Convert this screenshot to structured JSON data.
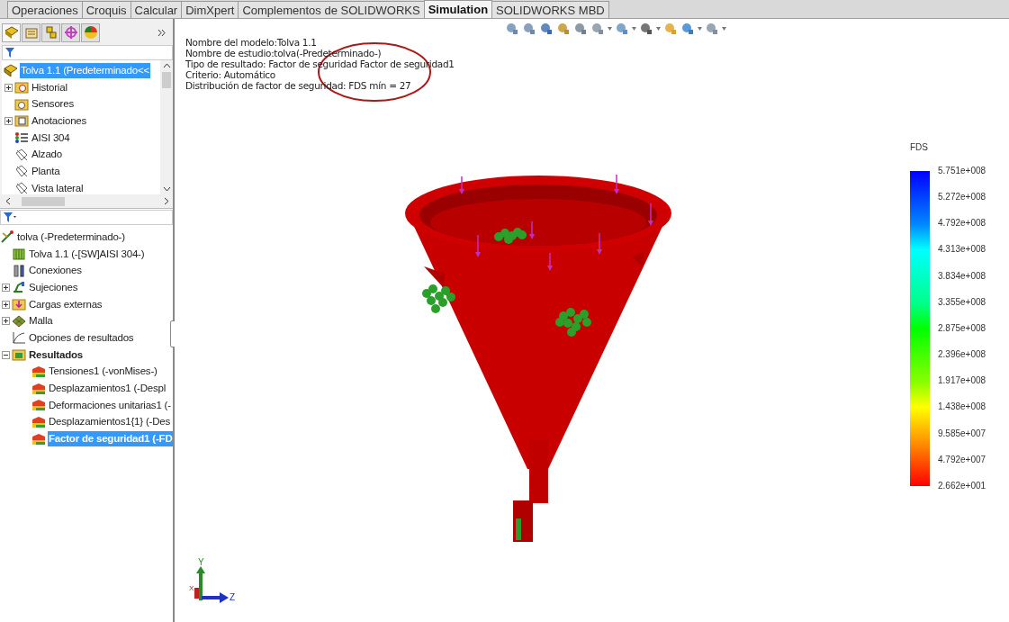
{
  "tabs": [
    {
      "label": "Operaciones",
      "selected": false
    },
    {
      "label": "Croquis",
      "selected": false
    },
    {
      "label": "Calcular",
      "selected": false
    },
    {
      "label": "DimXpert",
      "selected": false
    },
    {
      "label": "Complementos de SOLIDWORKS",
      "selected": false
    },
    {
      "label": "Simulation",
      "selected": true
    },
    {
      "label": "SOLIDWORKS MBD",
      "selected": false
    }
  ],
  "feature_tree": {
    "items": [
      {
        "label": "Tolva 1.1  (Predeterminado<<",
        "kind": "part",
        "selected": true,
        "bold": false,
        "children": [
          {
            "label": "Historial",
            "kind": "history",
            "expanded": false,
            "selected": false,
            "bold": false
          },
          {
            "label": "Sensores",
            "kind": "sensor",
            "selected": false,
            "bold": false
          },
          {
            "label": "Anotaciones",
            "kind": "annotation",
            "expanded": false,
            "selected": false,
            "bold": false
          },
          {
            "label": "AISI 304",
            "kind": "material",
            "selected": false,
            "bold": false
          },
          {
            "label": "Alzado",
            "kind": "plane",
            "selected": false,
            "bold": false
          },
          {
            "label": "Planta",
            "kind": "plane",
            "selected": false,
            "bold": false
          },
          {
            "label": "Vista lateral",
            "kind": "plane",
            "selected": false,
            "bold": false
          }
        ]
      }
    ]
  },
  "study_tree": {
    "items": [
      {
        "label": "tolva (-Predeterminado-)",
        "kind": "study",
        "selected": false,
        "bold": false,
        "children": [
          {
            "label": "Tolva 1.1 (-[SW]AISI 304-)",
            "kind": "body",
            "selected": false,
            "bold": false
          },
          {
            "label": "Conexiones",
            "kind": "connections",
            "selected": false,
            "bold": false
          },
          {
            "label": "Sujeciones",
            "kind": "fixtures",
            "expanded": false,
            "selected": false,
            "bold": false
          },
          {
            "label": "Cargas externas",
            "kind": "loads",
            "expanded": false,
            "selected": false,
            "bold": false
          },
          {
            "label": "Malla",
            "kind": "mesh",
            "expanded": false,
            "selected": false,
            "bold": false
          },
          {
            "label": "Opciones de resultados",
            "kind": "options",
            "selected": false,
            "bold": false
          },
          {
            "label": "Resultados",
            "kind": "results",
            "expanded": true,
            "selected": false,
            "bold": true,
            "children": [
              {
                "label": "Tensiones1 (-vonMises-)",
                "kind": "plot",
                "selected": false,
                "bold": false
              },
              {
                "label": "Desplazamientos1 (-Despl",
                "kind": "plot",
                "selected": false,
                "bold": false
              },
              {
                "label": "Deformaciones unitarias1 (-",
                "kind": "plot",
                "selected": false,
                "bold": false
              },
              {
                "label": "Desplazamientos1{1} (-Des",
                "kind": "plot",
                "selected": false,
                "bold": false
              },
              {
                "label": "Factor de seguridad1 (-FD",
                "kind": "plot",
                "selected": true,
                "bold": true
              }
            ]
          }
        ]
      }
    ]
  },
  "info_lines": [
    "Nombre del modelo:Tolva 1.1",
    "Nombre de estudio:tolva(-Predeterminado-)",
    "Tipo de resultado: Factor de seguridad Factor de seguridad1",
    "Criterio: Automático",
    "Distribución de factor de seguridad: FDS mín = 27"
  ],
  "legend": {
    "title": "FDS",
    "labels": [
      "5.751e+008",
      "5.272e+008",
      "4.792e+008",
      "4.313e+008",
      "3.834e+008",
      "3.355e+008",
      "2.875e+008",
      "2.396e+008",
      "1.917e+008",
      "1.438e+008",
      "9.585e+007",
      "4.792e+007",
      "2.662e+001"
    ]
  },
  "triad": {
    "y": "Y",
    "z": "Z",
    "x": "X"
  }
}
